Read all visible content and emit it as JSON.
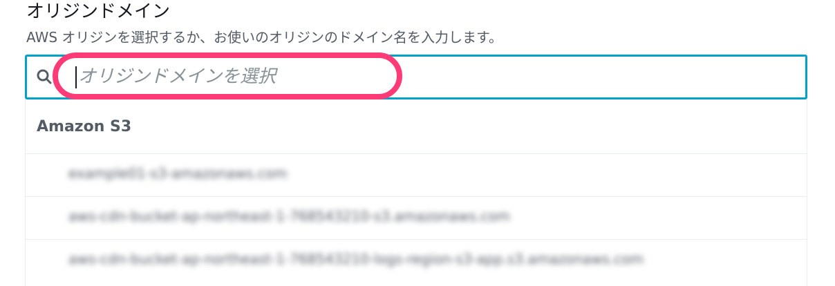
{
  "field": {
    "label": "オリジンドメイン",
    "description": "AWS オリジンを選択するか、お使いのオリジンのドメイン名を入力します。"
  },
  "search": {
    "placeholder": "オリジンドメインを選択",
    "value": ""
  },
  "dropdown": {
    "group_header": "Amazon S3",
    "options": [
      {
        "label": "example01-s3-amazonaws.com",
        "blurred": true
      },
      {
        "label": "aws-cdn-bucket-ap-northeast-1-768543210-s3.amazonaws.com",
        "blurred": true
      },
      {
        "label": "aws-cdn-bucket-ap-northeast-1-768543210-logs-region-s3-app.s3.amazonaws.com",
        "blurred": true
      }
    ]
  },
  "colors": {
    "focus_border": "#00a1c9",
    "highlight_ring": "#ff3b77",
    "text_primary": "#16191f",
    "text_secondary": "#545b64",
    "placeholder": "#879196"
  },
  "icons": {
    "search": "search-icon"
  }
}
